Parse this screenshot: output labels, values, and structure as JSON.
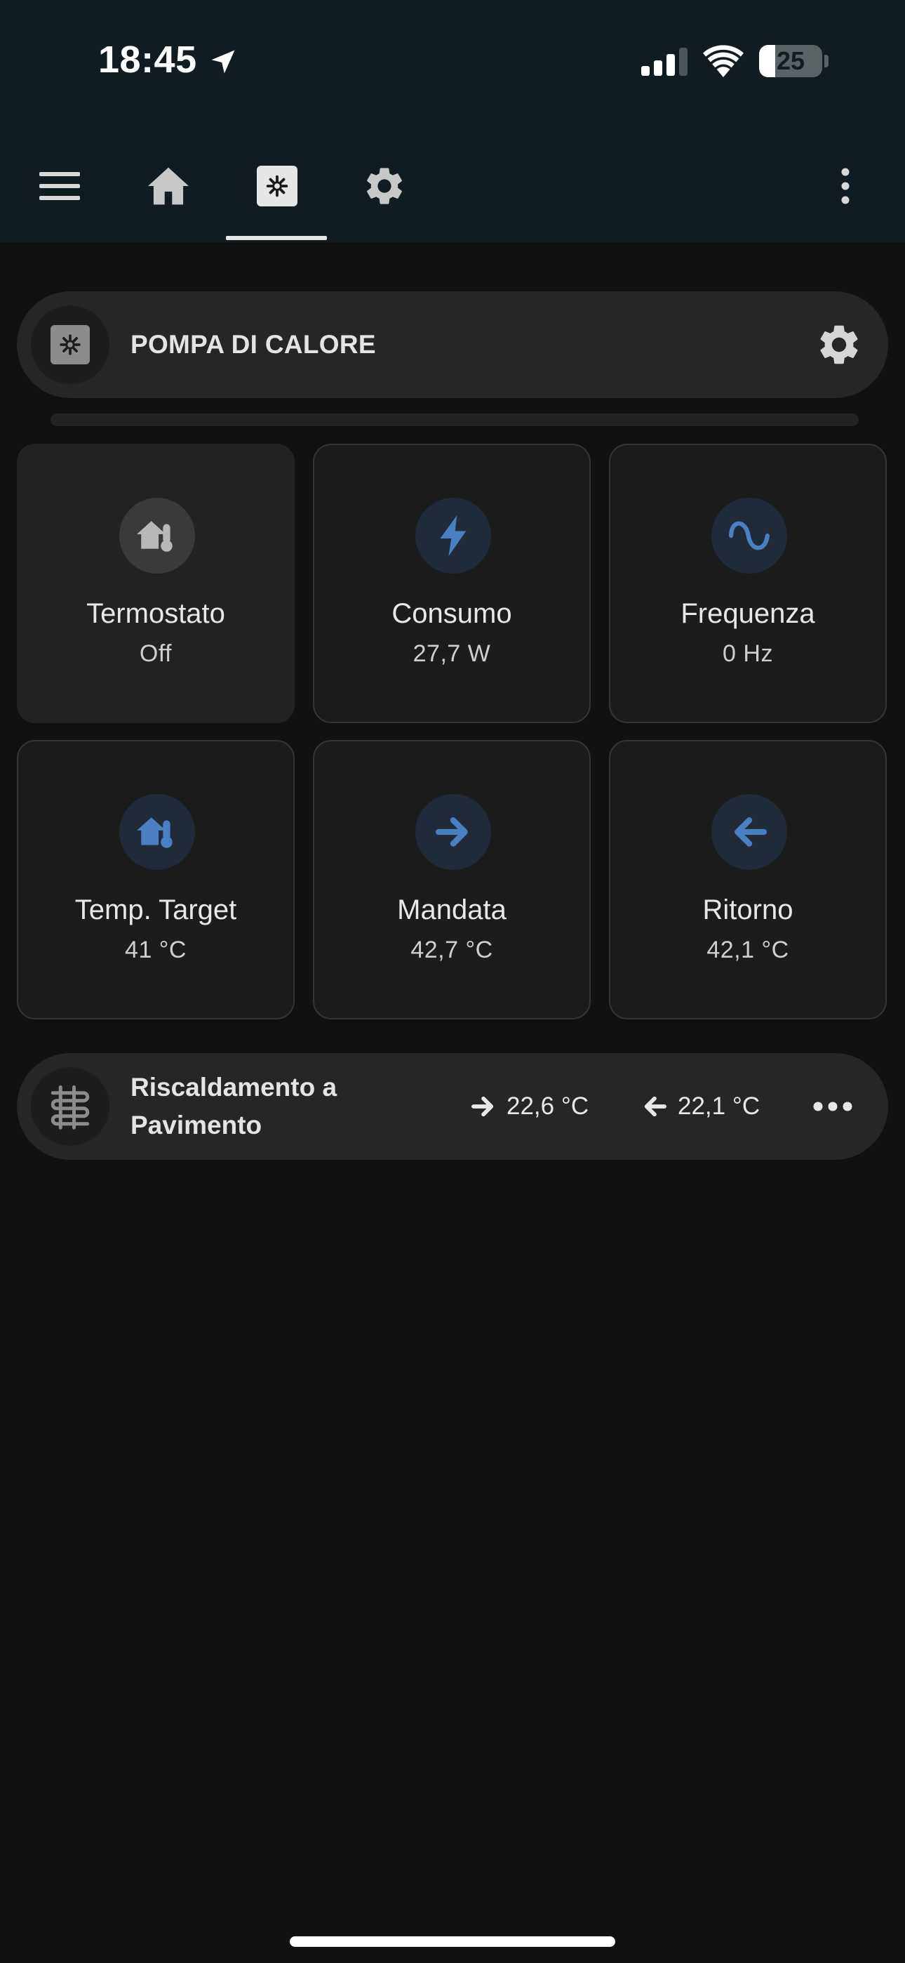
{
  "status_bar": {
    "time": "18:45",
    "battery": "25",
    "battery_level": 0.25
  },
  "toolbar": {
    "icons": [
      "menu-icon",
      "home-icon",
      "heat-pump-icon",
      "gear-icon",
      "more-vert-icon"
    ],
    "active_tab": "heat-pump"
  },
  "header": {
    "title": "POMPA DI CALORE"
  },
  "tiles": [
    {
      "name": "Termostato",
      "value": "Off",
      "icon": "home-thermometer-icon",
      "active": true
    },
    {
      "name": "Consumo",
      "value": "27,7 W",
      "icon": "lightning-icon"
    },
    {
      "name": "Frequenza",
      "value": "0 Hz",
      "icon": "sine-wave-icon"
    },
    {
      "name": "Temp. Target",
      "value": "41 °C",
      "icon": "home-thermometer-icon"
    },
    {
      "name": "Mandata",
      "value": "42,7 °C",
      "icon": "arrow-right-icon"
    },
    {
      "name": "Ritorno",
      "value": "42,1 °C",
      "icon": "arrow-left-icon"
    }
  ],
  "floor_heating": {
    "title_line1": "Riscaldamento a",
    "title_line2": "Pavimento",
    "supply": "22,6 °C",
    "return": "22,1 °C"
  },
  "colors": {
    "background": "#111111",
    "bar": "#111c22",
    "card": "#262626",
    "accent_blue": "#4a7fc1",
    "icon_grey": "#b8b8b8"
  }
}
